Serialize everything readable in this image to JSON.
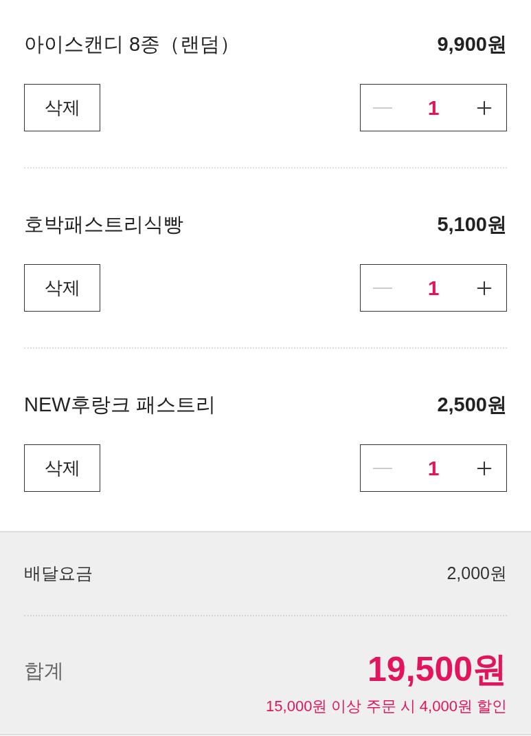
{
  "items": [
    {
      "name": "아이스캔디 8종（랜덤）",
      "price": "9,900원",
      "delete_label": "삭제",
      "quantity": "1",
      "minus_disabled": true
    },
    {
      "name": "호박패스트리식빵",
      "price": "5,100원",
      "delete_label": "삭제",
      "quantity": "1",
      "minus_disabled": true
    },
    {
      "name": "NEW후랑크 패스트리",
      "price": "2,500원",
      "delete_label": "삭제",
      "quantity": "1",
      "minus_disabled": true
    }
  ],
  "summary": {
    "delivery_label": "배달요금",
    "delivery_fee": "2,000원",
    "total_label": "합계",
    "total": "19,500원",
    "discount_note": "15,000원 이상 주문 시 4,000원 할인"
  }
}
